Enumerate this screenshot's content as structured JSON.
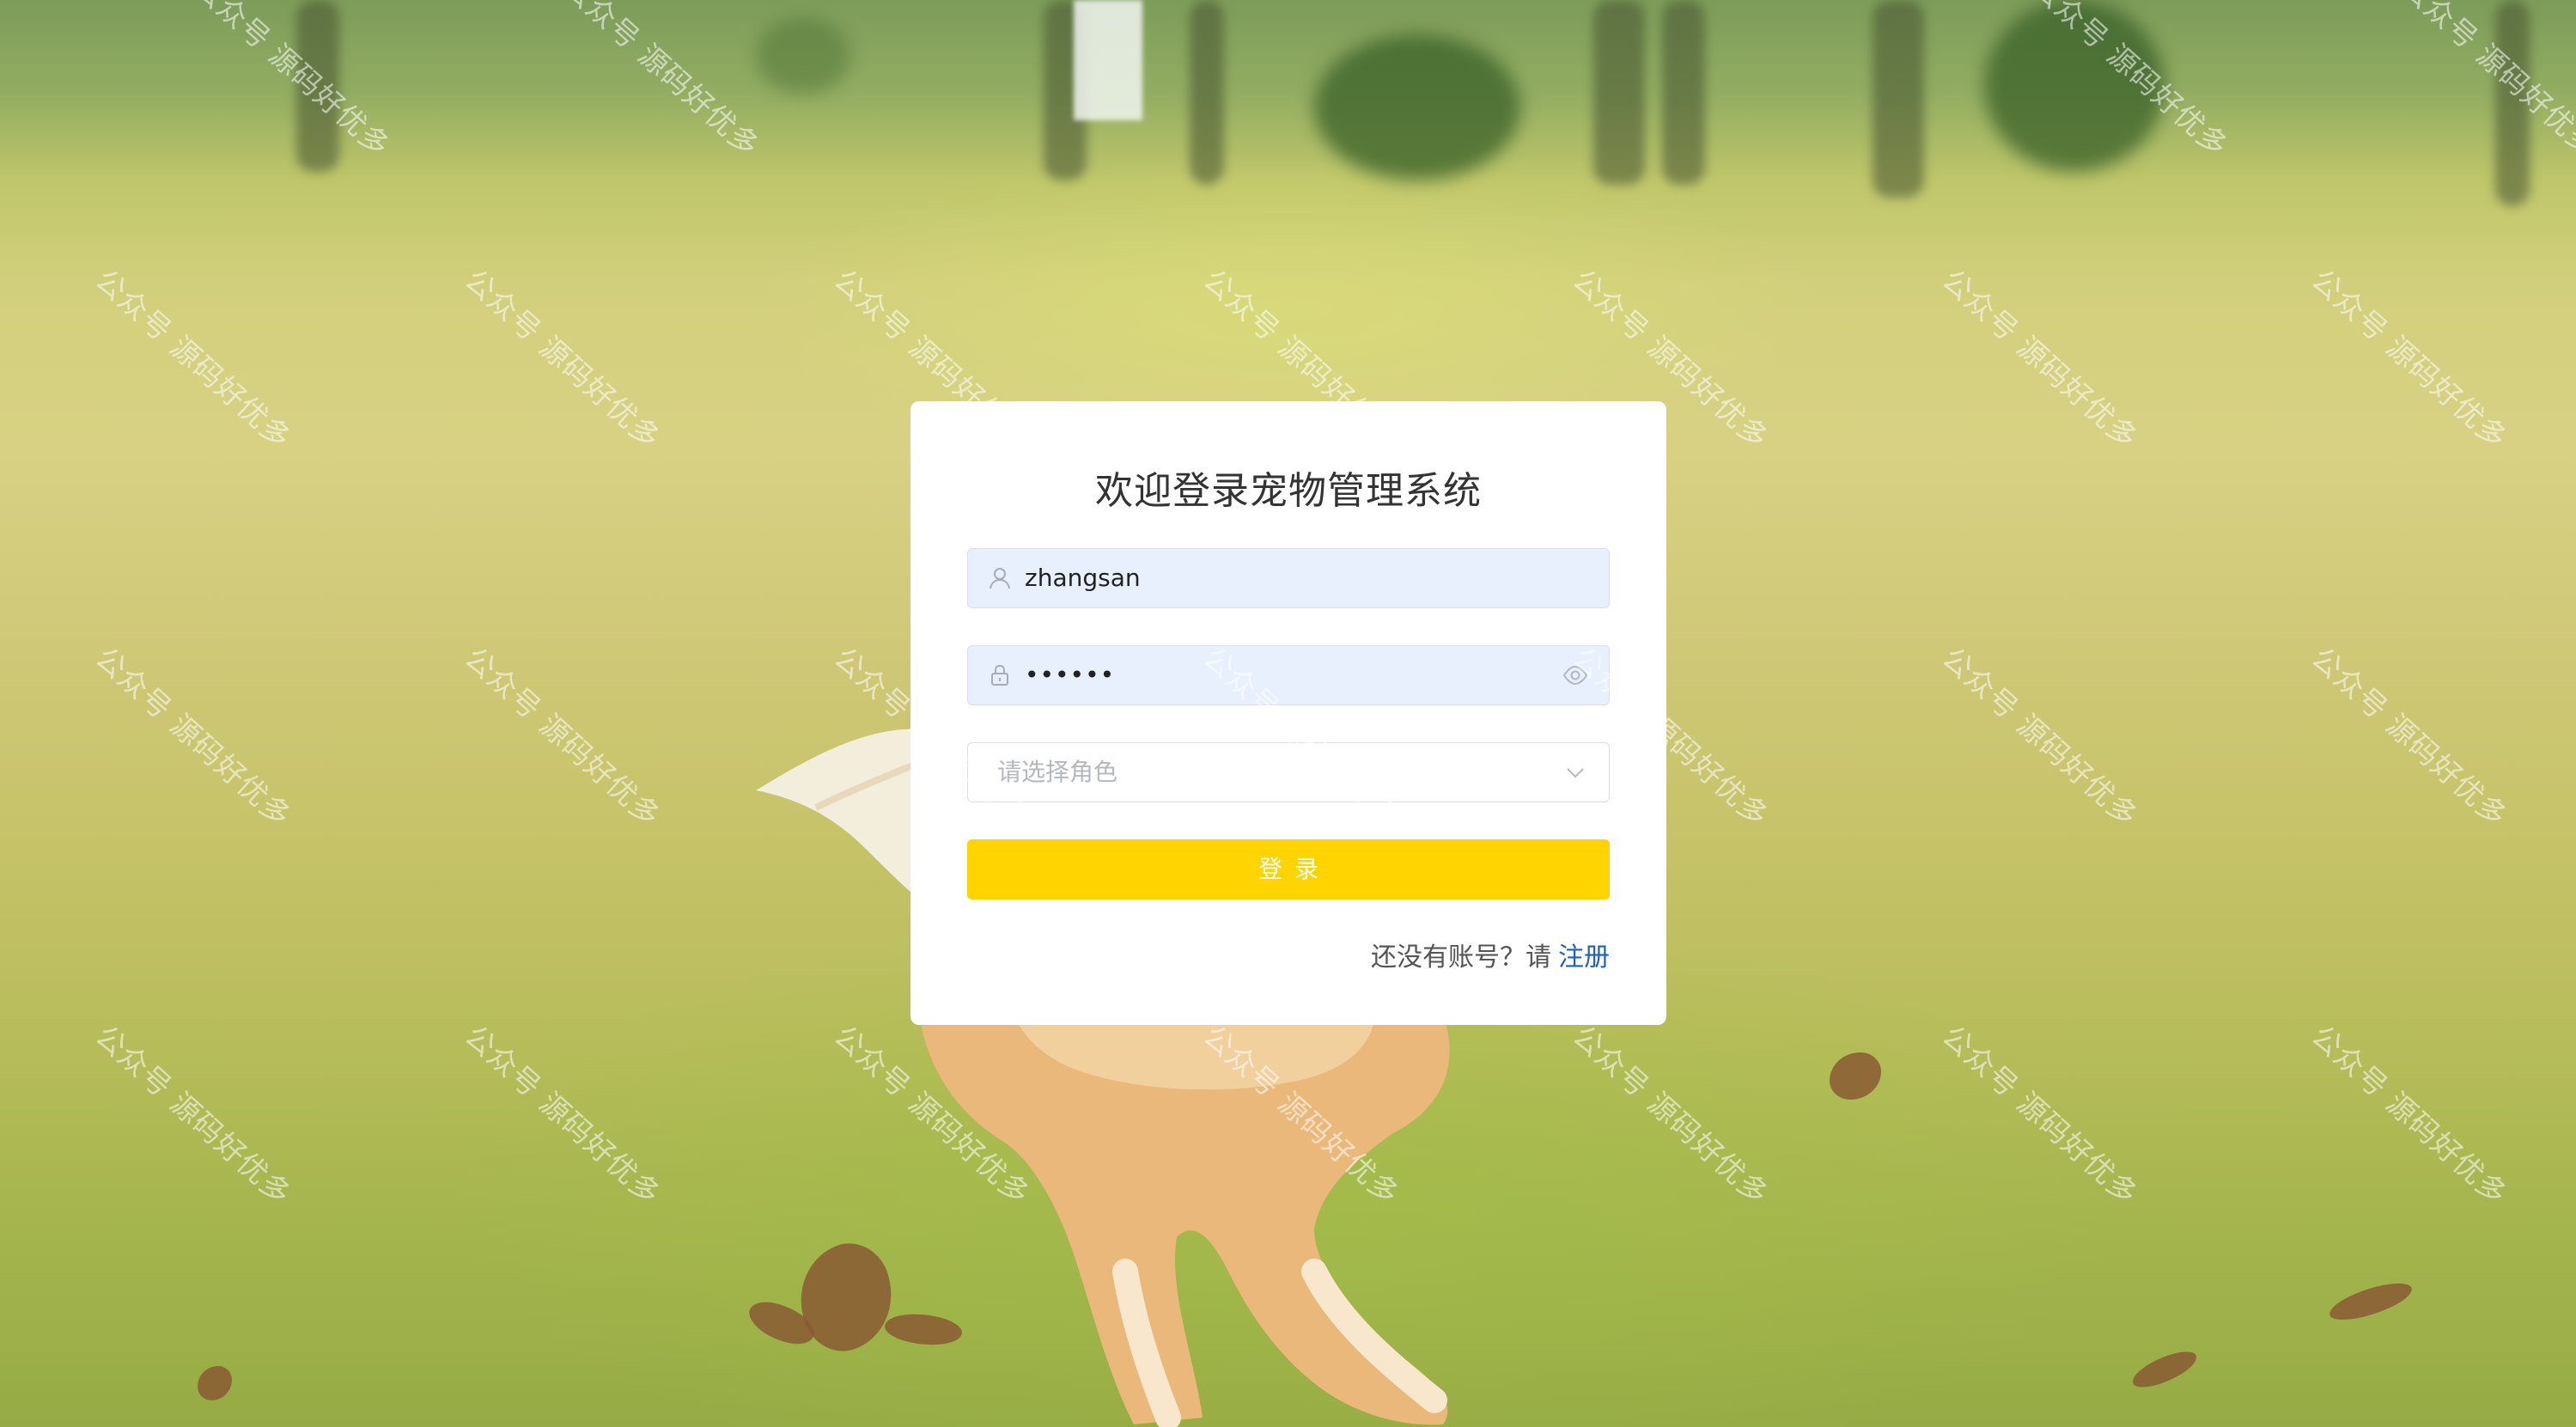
{
  "login": {
    "title": "欢迎登录宠物管理系统",
    "username": {
      "value": "zhangsan",
      "icon": "user-icon"
    },
    "password": {
      "value": "••••••",
      "icon": "lock-icon",
      "toggle_icon": "eye-icon"
    },
    "role": {
      "placeholder": "请选择角色",
      "icon": "chevron-down-icon"
    },
    "submit_label": "登录",
    "register_prompt": "还没有账号？请",
    "register_link": "注册"
  },
  "watermark": {
    "text": "公众号 源码好优多"
  },
  "colors": {
    "accent_button": "#ffd400",
    "link": "#1f5fbf",
    "autofill_bg": "#e8f0fe"
  }
}
